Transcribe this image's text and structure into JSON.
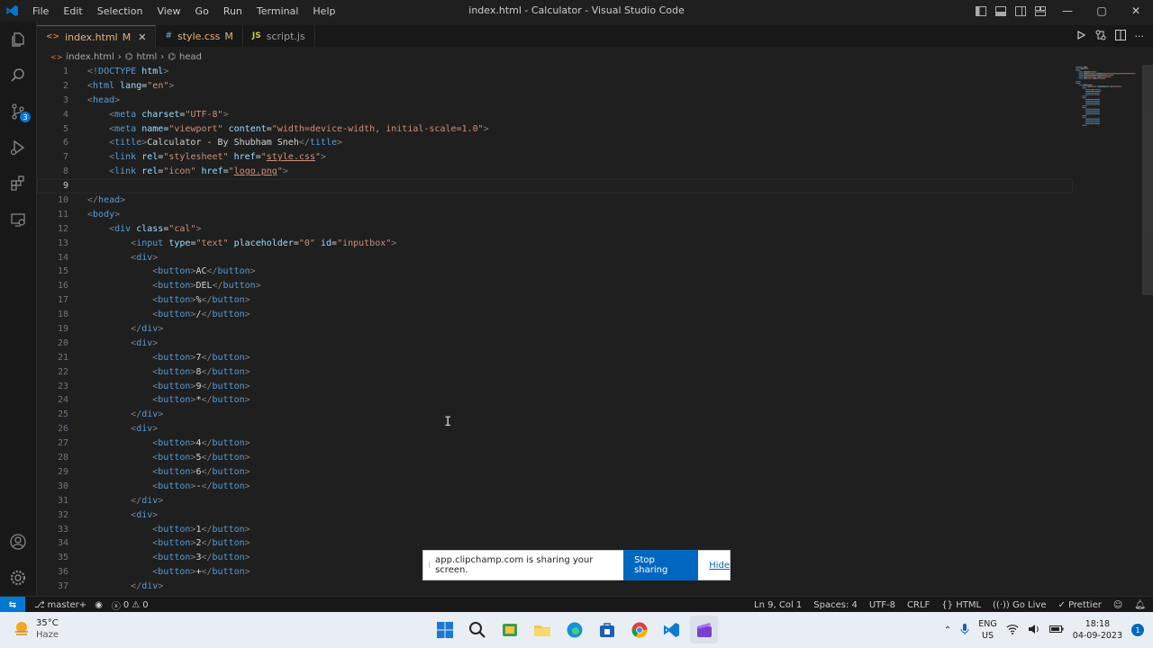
{
  "window": {
    "title": "index.html - Calculator - Visual Studio Code",
    "menu": [
      "File",
      "Edit",
      "Selection",
      "View",
      "Go",
      "Run",
      "Terminal",
      "Help"
    ],
    "controls": {
      "minimize": "—",
      "maximize": "▢",
      "close": "✕"
    }
  },
  "activity_bar": {
    "items": [
      "explorer-icon",
      "search-icon",
      "source-control-icon",
      "run-debug-icon",
      "extensions-icon",
      "remote-explorer-icon"
    ],
    "source_control_badge": "3",
    "bottom": [
      "accounts-icon",
      "manage-gear-icon"
    ]
  },
  "tabs": [
    {
      "icon": "<>",
      "label": "index.html",
      "modified": "M",
      "close": "✕",
      "active": true,
      "color": "#e37933"
    },
    {
      "icon": "#",
      "label": "style.css",
      "modified": "M",
      "active": false,
      "color": "#519aba"
    },
    {
      "icon": "JS",
      "label": "script.js",
      "modified": "",
      "active": false,
      "color": "#cbcb41"
    }
  ],
  "breadcrumb": {
    "file": "index.html",
    "sep1": "›",
    "item1": "html",
    "sep2": "›",
    "item2": "head"
  },
  "editor": {
    "current_line": 9,
    "lines": [
      [
        {
          "c": "p",
          "v": "<!"
        },
        {
          "c": "t",
          "v": "DOCTYPE"
        },
        {
          "c": "x",
          "v": " "
        },
        {
          "c": "a",
          "v": "html"
        },
        {
          "c": "p",
          "v": ">"
        }
      ],
      [
        {
          "c": "p",
          "v": "<"
        },
        {
          "c": "t",
          "v": "html"
        },
        {
          "c": "x",
          "v": " "
        },
        {
          "c": "a",
          "v": "lang"
        },
        {
          "c": "x",
          "v": "="
        },
        {
          "c": "s",
          "v": "\"en\""
        },
        {
          "c": "p",
          "v": ">"
        }
      ],
      [
        {
          "c": "p",
          "v": "<"
        },
        {
          "c": "t",
          "v": "head"
        },
        {
          "c": "p",
          "v": ">"
        }
      ],
      [
        {
          "c": "x",
          "v": "    "
        },
        {
          "c": "p",
          "v": "<"
        },
        {
          "c": "t",
          "v": "meta"
        },
        {
          "c": "x",
          "v": " "
        },
        {
          "c": "a",
          "v": "charset"
        },
        {
          "c": "x",
          "v": "="
        },
        {
          "c": "s",
          "v": "\"UTF-8\""
        },
        {
          "c": "p",
          "v": ">"
        }
      ],
      [
        {
          "c": "x",
          "v": "    "
        },
        {
          "c": "p",
          "v": "<"
        },
        {
          "c": "t",
          "v": "meta"
        },
        {
          "c": "x",
          "v": " "
        },
        {
          "c": "a",
          "v": "name"
        },
        {
          "c": "x",
          "v": "="
        },
        {
          "c": "s",
          "v": "\"viewport\""
        },
        {
          "c": "x",
          "v": " "
        },
        {
          "c": "a",
          "v": "content"
        },
        {
          "c": "x",
          "v": "="
        },
        {
          "c": "s",
          "v": "\"width=device-width, initial-scale=1.0\""
        },
        {
          "c": "p",
          "v": ">"
        }
      ],
      [
        {
          "c": "x",
          "v": "    "
        },
        {
          "c": "p",
          "v": "<"
        },
        {
          "c": "t",
          "v": "title"
        },
        {
          "c": "p",
          "v": ">"
        },
        {
          "c": "x",
          "v": "Calculator - By Shubham Sneh"
        },
        {
          "c": "p",
          "v": "</"
        },
        {
          "c": "t",
          "v": "title"
        },
        {
          "c": "p",
          "v": ">"
        }
      ],
      [
        {
          "c": "x",
          "v": "    "
        },
        {
          "c": "p",
          "v": "<"
        },
        {
          "c": "t",
          "v": "link"
        },
        {
          "c": "x",
          "v": " "
        },
        {
          "c": "a",
          "v": "rel"
        },
        {
          "c": "x",
          "v": "="
        },
        {
          "c": "s",
          "v": "\"stylesheet\""
        },
        {
          "c": "x",
          "v": " "
        },
        {
          "c": "a",
          "v": "href"
        },
        {
          "c": "x",
          "v": "="
        },
        {
          "c": "s",
          "v": "\""
        },
        {
          "c": "su",
          "v": "style.css"
        },
        {
          "c": "s",
          "v": "\""
        },
        {
          "c": "p",
          "v": ">"
        }
      ],
      [
        {
          "c": "x",
          "v": "    "
        },
        {
          "c": "p",
          "v": "<"
        },
        {
          "c": "t",
          "v": "link"
        },
        {
          "c": "x",
          "v": " "
        },
        {
          "c": "a",
          "v": "rel"
        },
        {
          "c": "x",
          "v": "="
        },
        {
          "c": "s",
          "v": "\"icon\""
        },
        {
          "c": "x",
          "v": " "
        },
        {
          "c": "a",
          "v": "href"
        },
        {
          "c": "x",
          "v": "="
        },
        {
          "c": "s",
          "v": "\""
        },
        {
          "c": "su",
          "v": "logo.png"
        },
        {
          "c": "s",
          "v": "\""
        },
        {
          "c": "p",
          "v": ">"
        }
      ],
      [
        {
          "c": "x",
          "v": ""
        }
      ],
      [
        {
          "c": "p",
          "v": "</"
        },
        {
          "c": "t",
          "v": "head"
        },
        {
          "c": "p",
          "v": ">"
        }
      ],
      [
        {
          "c": "p",
          "v": "<"
        },
        {
          "c": "t",
          "v": "body"
        },
        {
          "c": "p",
          "v": ">"
        }
      ],
      [
        {
          "c": "x",
          "v": "    "
        },
        {
          "c": "p",
          "v": "<"
        },
        {
          "c": "t",
          "v": "div"
        },
        {
          "c": "x",
          "v": " "
        },
        {
          "c": "a",
          "v": "class"
        },
        {
          "c": "x",
          "v": "="
        },
        {
          "c": "s",
          "v": "\"cal\""
        },
        {
          "c": "p",
          "v": ">"
        }
      ],
      [
        {
          "c": "x",
          "v": "        "
        },
        {
          "c": "p",
          "v": "<"
        },
        {
          "c": "t",
          "v": "input"
        },
        {
          "c": "x",
          "v": " "
        },
        {
          "c": "a",
          "v": "type"
        },
        {
          "c": "x",
          "v": "="
        },
        {
          "c": "s",
          "v": "\"text\""
        },
        {
          "c": "x",
          "v": " "
        },
        {
          "c": "a",
          "v": "placeholder"
        },
        {
          "c": "x",
          "v": "="
        },
        {
          "c": "s",
          "v": "\"0\""
        },
        {
          "c": "x",
          "v": " "
        },
        {
          "c": "a",
          "v": "id"
        },
        {
          "c": "x",
          "v": "="
        },
        {
          "c": "s",
          "v": "\"inputbox\""
        },
        {
          "c": "p",
          "v": ">"
        }
      ],
      [
        {
          "c": "x",
          "v": "        "
        },
        {
          "c": "p",
          "v": "<"
        },
        {
          "c": "t",
          "v": "div"
        },
        {
          "c": "p",
          "v": ">"
        }
      ],
      [
        {
          "c": "x",
          "v": "            "
        },
        {
          "c": "p",
          "v": "<"
        },
        {
          "c": "t",
          "v": "button"
        },
        {
          "c": "p",
          "v": ">"
        },
        {
          "c": "x",
          "v": "AC"
        },
        {
          "c": "p",
          "v": "</"
        },
        {
          "c": "t",
          "v": "button"
        },
        {
          "c": "p",
          "v": ">"
        }
      ],
      [
        {
          "c": "x",
          "v": "            "
        },
        {
          "c": "p",
          "v": "<"
        },
        {
          "c": "t",
          "v": "button"
        },
        {
          "c": "p",
          "v": ">"
        },
        {
          "c": "x",
          "v": "DEL"
        },
        {
          "c": "p",
          "v": "</"
        },
        {
          "c": "t",
          "v": "button"
        },
        {
          "c": "p",
          "v": ">"
        }
      ],
      [
        {
          "c": "x",
          "v": "            "
        },
        {
          "c": "p",
          "v": "<"
        },
        {
          "c": "t",
          "v": "button"
        },
        {
          "c": "p",
          "v": ">"
        },
        {
          "c": "x",
          "v": "%"
        },
        {
          "c": "p",
          "v": "</"
        },
        {
          "c": "t",
          "v": "button"
        },
        {
          "c": "p",
          "v": ">"
        }
      ],
      [
        {
          "c": "x",
          "v": "            "
        },
        {
          "c": "p",
          "v": "<"
        },
        {
          "c": "t",
          "v": "button"
        },
        {
          "c": "p",
          "v": ">"
        },
        {
          "c": "x",
          "v": "/"
        },
        {
          "c": "p",
          "v": "</"
        },
        {
          "c": "t",
          "v": "button"
        },
        {
          "c": "p",
          "v": ">"
        }
      ],
      [
        {
          "c": "x",
          "v": "        "
        },
        {
          "c": "p",
          "v": "</"
        },
        {
          "c": "t",
          "v": "div"
        },
        {
          "c": "p",
          "v": ">"
        }
      ],
      [
        {
          "c": "x",
          "v": "        "
        },
        {
          "c": "p",
          "v": "<"
        },
        {
          "c": "t",
          "v": "div"
        },
        {
          "c": "p",
          "v": ">"
        }
      ],
      [
        {
          "c": "x",
          "v": "            "
        },
        {
          "c": "p",
          "v": "<"
        },
        {
          "c": "t",
          "v": "button"
        },
        {
          "c": "p",
          "v": ">"
        },
        {
          "c": "x",
          "v": "7"
        },
        {
          "c": "p",
          "v": "</"
        },
        {
          "c": "t",
          "v": "button"
        },
        {
          "c": "p",
          "v": ">"
        }
      ],
      [
        {
          "c": "x",
          "v": "            "
        },
        {
          "c": "p",
          "v": "<"
        },
        {
          "c": "t",
          "v": "button"
        },
        {
          "c": "p",
          "v": ">"
        },
        {
          "c": "x",
          "v": "8"
        },
        {
          "c": "p",
          "v": "</"
        },
        {
          "c": "t",
          "v": "button"
        },
        {
          "c": "p",
          "v": ">"
        }
      ],
      [
        {
          "c": "x",
          "v": "            "
        },
        {
          "c": "p",
          "v": "<"
        },
        {
          "c": "t",
          "v": "button"
        },
        {
          "c": "p",
          "v": ">"
        },
        {
          "c": "x",
          "v": "9"
        },
        {
          "c": "p",
          "v": "</"
        },
        {
          "c": "t",
          "v": "button"
        },
        {
          "c": "p",
          "v": ">"
        }
      ],
      [
        {
          "c": "x",
          "v": "            "
        },
        {
          "c": "p",
          "v": "<"
        },
        {
          "c": "t",
          "v": "button"
        },
        {
          "c": "p",
          "v": ">"
        },
        {
          "c": "x",
          "v": "*"
        },
        {
          "c": "p",
          "v": "</"
        },
        {
          "c": "t",
          "v": "button"
        },
        {
          "c": "p",
          "v": ">"
        }
      ],
      [
        {
          "c": "x",
          "v": "        "
        },
        {
          "c": "p",
          "v": "</"
        },
        {
          "c": "t",
          "v": "div"
        },
        {
          "c": "p",
          "v": ">"
        }
      ],
      [
        {
          "c": "x",
          "v": "        "
        },
        {
          "c": "p",
          "v": "<"
        },
        {
          "c": "t",
          "v": "div"
        },
        {
          "c": "p",
          "v": ">"
        }
      ],
      [
        {
          "c": "x",
          "v": "            "
        },
        {
          "c": "p",
          "v": "<"
        },
        {
          "c": "t",
          "v": "button"
        },
        {
          "c": "p",
          "v": ">"
        },
        {
          "c": "x",
          "v": "4"
        },
        {
          "c": "p",
          "v": "</"
        },
        {
          "c": "t",
          "v": "button"
        },
        {
          "c": "p",
          "v": ">"
        }
      ],
      [
        {
          "c": "x",
          "v": "            "
        },
        {
          "c": "p",
          "v": "<"
        },
        {
          "c": "t",
          "v": "button"
        },
        {
          "c": "p",
          "v": ">"
        },
        {
          "c": "x",
          "v": "5"
        },
        {
          "c": "p",
          "v": "</"
        },
        {
          "c": "t",
          "v": "button"
        },
        {
          "c": "p",
          "v": ">"
        }
      ],
      [
        {
          "c": "x",
          "v": "            "
        },
        {
          "c": "p",
          "v": "<"
        },
        {
          "c": "t",
          "v": "button"
        },
        {
          "c": "p",
          "v": ">"
        },
        {
          "c": "x",
          "v": "6"
        },
        {
          "c": "p",
          "v": "</"
        },
        {
          "c": "t",
          "v": "button"
        },
        {
          "c": "p",
          "v": ">"
        }
      ],
      [
        {
          "c": "x",
          "v": "            "
        },
        {
          "c": "p",
          "v": "<"
        },
        {
          "c": "t",
          "v": "button"
        },
        {
          "c": "p",
          "v": ">"
        },
        {
          "c": "x",
          "v": "-"
        },
        {
          "c": "p",
          "v": "</"
        },
        {
          "c": "t",
          "v": "button"
        },
        {
          "c": "p",
          "v": ">"
        }
      ],
      [
        {
          "c": "x",
          "v": "        "
        },
        {
          "c": "p",
          "v": "</"
        },
        {
          "c": "t",
          "v": "div"
        },
        {
          "c": "p",
          "v": ">"
        }
      ],
      [
        {
          "c": "x",
          "v": "        "
        },
        {
          "c": "p",
          "v": "<"
        },
        {
          "c": "t",
          "v": "div"
        },
        {
          "c": "p",
          "v": ">"
        }
      ],
      [
        {
          "c": "x",
          "v": "            "
        },
        {
          "c": "p",
          "v": "<"
        },
        {
          "c": "t",
          "v": "button"
        },
        {
          "c": "p",
          "v": ">"
        },
        {
          "c": "x",
          "v": "1"
        },
        {
          "c": "p",
          "v": "</"
        },
        {
          "c": "t",
          "v": "button"
        },
        {
          "c": "p",
          "v": ">"
        }
      ],
      [
        {
          "c": "x",
          "v": "            "
        },
        {
          "c": "p",
          "v": "<"
        },
        {
          "c": "t",
          "v": "button"
        },
        {
          "c": "p",
          "v": ">"
        },
        {
          "c": "x",
          "v": "2"
        },
        {
          "c": "p",
          "v": "</"
        },
        {
          "c": "t",
          "v": "button"
        },
        {
          "c": "p",
          "v": ">"
        }
      ],
      [
        {
          "c": "x",
          "v": "            "
        },
        {
          "c": "p",
          "v": "<"
        },
        {
          "c": "t",
          "v": "button"
        },
        {
          "c": "p",
          "v": ">"
        },
        {
          "c": "x",
          "v": "3"
        },
        {
          "c": "p",
          "v": "</"
        },
        {
          "c": "t",
          "v": "button"
        },
        {
          "c": "p",
          "v": ">"
        }
      ],
      [
        {
          "c": "x",
          "v": "            "
        },
        {
          "c": "p",
          "v": "<"
        },
        {
          "c": "t",
          "v": "button"
        },
        {
          "c": "p",
          "v": ">"
        },
        {
          "c": "x",
          "v": "+"
        },
        {
          "c": "p",
          "v": "</"
        },
        {
          "c": "t",
          "v": "button"
        },
        {
          "c": "p",
          "v": ">"
        }
      ],
      [
        {
          "c": "x",
          "v": "        "
        },
        {
          "c": "p",
          "v": "</"
        },
        {
          "c": "t",
          "v": "div"
        },
        {
          "c": "p",
          "v": ">"
        }
      ]
    ]
  },
  "share_banner": {
    "message": "app.clipchamp.com is sharing your screen.",
    "stop_label": "Stop sharing",
    "hide_label": "Hide"
  },
  "status_bar": {
    "remote": "⇆",
    "branch": "master+",
    "errors": "0",
    "warnings": "0",
    "position": "Ln 9, Col 1",
    "spaces": "Spaces: 4",
    "encoding": "UTF-8",
    "eol": "CRLF",
    "language": "HTML",
    "go_live": "Go Live",
    "prettier": "Prettier"
  },
  "taskbar": {
    "weather_temp": "35°C",
    "weather_desc": "Haze",
    "apps": [
      "windows-start-icon",
      "search-icon",
      "widgets-icon",
      "file-explorer-icon",
      "edge-icon",
      "store-icon",
      "chrome-icon",
      "vscode-icon",
      "clipchamp-icon"
    ],
    "lang_top": "ENG",
    "lang_bottom": "US",
    "time": "18:18",
    "date": "04-09-2023",
    "notifications": "1"
  }
}
